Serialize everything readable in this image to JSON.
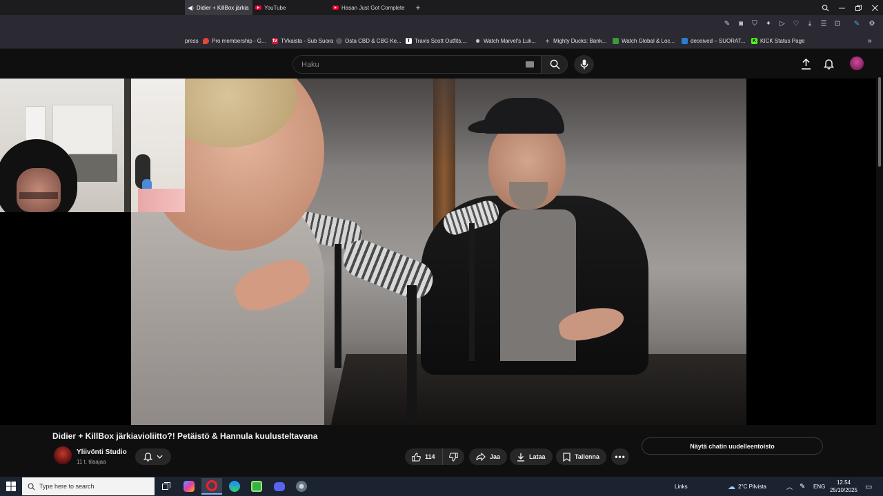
{
  "browser": {
    "tabs": [
      {
        "label": "Didier + KillBox järkia",
        "active": true
      },
      {
        "label": "YouTube",
        "active": false
      },
      {
        "label": "Hasan Just Got Complete",
        "active": false
      }
    ],
    "new_tab_label": "+"
  },
  "bookmarks": [
    {
      "label": "press",
      "icon": "bookmark-icon",
      "color": "#2b2a33"
    },
    {
      "label": "Pro membership - G...",
      "icon": "location-pin-icon",
      "color": "#e8453c"
    },
    {
      "label": "TVkaista - Sub Suora",
      "icon": "tv-icon",
      "color": "#c41e3a"
    },
    {
      "label": "Osta CBD & CBG Ke...",
      "icon": "leaf-icon",
      "color": "#555555"
    },
    {
      "label": "Travis Scott Outfits,...",
      "icon": "t-icon",
      "color": "#ffffff"
    },
    {
      "label": "Watch Marvel's Luk...",
      "icon": "spinner-icon",
      "color": "#888888"
    },
    {
      "label": "Mighty Ducks: Bank...",
      "icon": "duck-icon",
      "color": "#777777"
    },
    {
      "label": "Watch Global & Loc...",
      "icon": "twitch-icon",
      "color": "#3a9b3a"
    },
    {
      "label": "deceived – SUORAT...",
      "icon": "blue-square-icon",
      "color": "#2b7cd3"
    },
    {
      "label": "KICK Status Page",
      "icon": "kick-icon",
      "color": "#53fc18"
    }
  ],
  "youtube": {
    "search_placeholder": "Haku",
    "video_title": "Didier + KillBox järkiavioliitto?! Petäistö & Hannula kuulusteltavana",
    "channel_name": "Yliivönti Studio",
    "subscribers": "11 t. tilaajaa",
    "like_count": "114",
    "share_label": "Jaa",
    "download_label": "Lataa",
    "save_label": "Tallenna",
    "chat_replay_label": "Näytä chatin uudelleentoisto"
  },
  "taskbar": {
    "search_placeholder": "Type here to search",
    "links_label": "Links",
    "weather": "2°C  Pilvista",
    "language": "ENG",
    "time": "12.54",
    "date": "25/10/2025"
  },
  "colors": {
    "youtube_red": "#ff0033",
    "background": "#0f0f0f",
    "taskbar": "#1b2330"
  }
}
